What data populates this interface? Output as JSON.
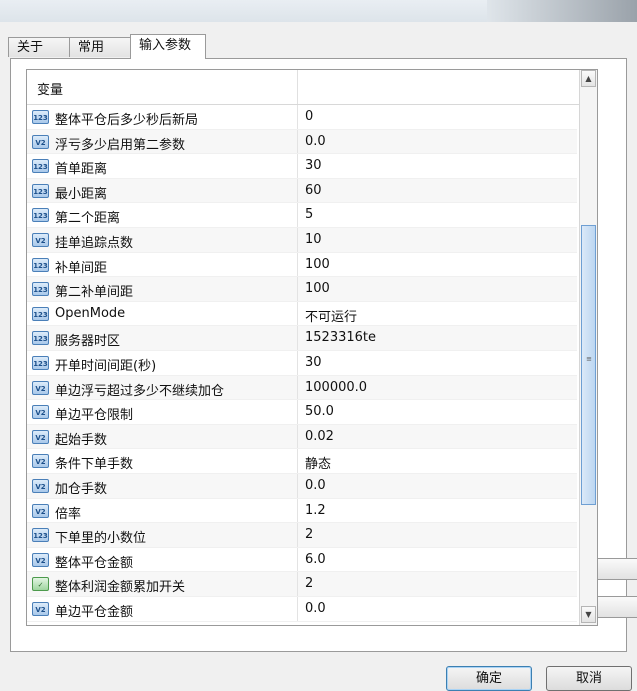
{
  "tabs": [
    {
      "label": "关于",
      "active": false
    },
    {
      "label": "常用",
      "active": false
    },
    {
      "label": "输入参数",
      "active": true
    }
  ],
  "grid": {
    "header": "变量",
    "rows": [
      {
        "name": "整体平仓后多少秒后新局",
        "value": "0",
        "icon": "int-icon"
      },
      {
        "name": "浮亏多少启用第二参数",
        "value": "0.0",
        "icon": "double-icon"
      },
      {
        "name": "首单距离",
        "value": "30",
        "icon": "int-icon"
      },
      {
        "name": "最小距离",
        "value": "60",
        "icon": "int-icon"
      },
      {
        "name": "第二个距离",
        "value": "5",
        "icon": "int-icon"
      },
      {
        "name": "挂单追踪点数",
        "value": "10",
        "icon": "double-icon"
      },
      {
        "name": "补单间距",
        "value": "100",
        "icon": "int-icon"
      },
      {
        "name": "第二补单间距",
        "value": "100",
        "icon": "int-icon"
      },
      {
        "name": "OpenMode",
        "value": "不可运行",
        "icon": "int-icon"
      },
      {
        "name": "服务器时区",
        "value": "1523316te",
        "icon": "int-icon"
      },
      {
        "name": "开单时间间距(秒)",
        "value": "30",
        "icon": "int-icon"
      },
      {
        "name": "单边浮亏超过多少不继续加仓",
        "value": "100000.0",
        "icon": "double-icon"
      },
      {
        "name": "单边平仓限制",
        "value": "50.0",
        "icon": "double-icon"
      },
      {
        "name": "起始手数",
        "value": "0.02",
        "icon": "double-icon"
      },
      {
        "name": "条件下单手数",
        "value": "静态",
        "icon": "double-icon"
      },
      {
        "name": "加仓手数",
        "value": "0.0",
        "icon": "double-icon"
      },
      {
        "name": "倍率",
        "value": "1.2",
        "icon": "double-icon"
      },
      {
        "name": "下单里的小数位",
        "value": "2",
        "icon": "int-icon"
      },
      {
        "name": "整体平仓金额",
        "value": "6.0",
        "icon": "double-icon"
      },
      {
        "name": "整体利润金额累加开关",
        "value": "2",
        "icon": "bool-icon"
      },
      {
        "name": "单边平仓金额",
        "value": "0.0",
        "icon": "double-icon"
      }
    ]
  },
  "buttons": {
    "ok": "确定",
    "cancel": "取消"
  }
}
